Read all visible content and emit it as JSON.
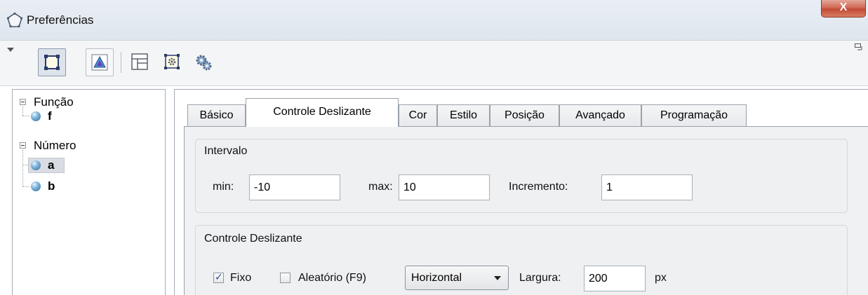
{
  "window": {
    "title": "Preferências",
    "close_label": "X"
  },
  "toolbar": {
    "items": [
      {
        "icon": "graphics-view-icon",
        "selected": true
      },
      {
        "icon": "graphics-objects-icon",
        "selected": false
      },
      {
        "icon": "layout-icon",
        "selected": false
      },
      {
        "icon": "defaults-icon",
        "selected": false
      },
      {
        "icon": "advanced-settings-icon",
        "selected": false
      }
    ]
  },
  "tree": {
    "groups": [
      {
        "label": "Função",
        "items": [
          {
            "label": "f",
            "selected": false
          }
        ]
      },
      {
        "label": "Número",
        "items": [
          {
            "label": "a",
            "selected": true
          },
          {
            "label": "b",
            "selected": false
          }
        ]
      }
    ]
  },
  "tabs": [
    "Básico",
    "Controle Deslizante",
    "Cor",
    "Estilo",
    "Posição",
    "Avançado",
    "Programação"
  ],
  "active_tab": "Controle Deslizante",
  "interval": {
    "title": "Intervalo",
    "min_label": "min:",
    "min_value": "-10",
    "max_label": "max:",
    "max_value": "10",
    "increment_label": "Incremento:",
    "increment_value": "1"
  },
  "slider": {
    "title": "Controle Deslizante",
    "fixed_label": "Fixo",
    "fixed_checked": true,
    "random_label": "Aleatório (F9)",
    "random_checked": false,
    "orientation_value": "Horizontal",
    "width_label": "Largura:",
    "width_value": "200",
    "width_unit": "px"
  },
  "colors": {
    "close_button": "#c24a35",
    "selection": "#d9dce3",
    "panel_bg": "#f0f1f3"
  }
}
